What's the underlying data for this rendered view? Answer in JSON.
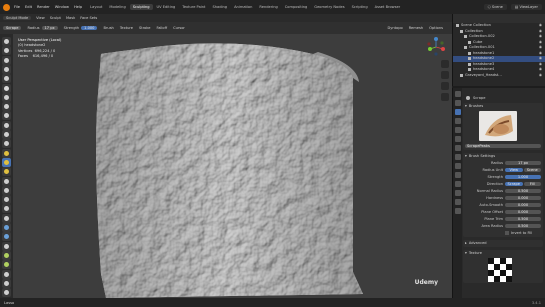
{
  "topbar": {
    "menus": [
      "File",
      "Edit",
      "Render",
      "Window",
      "Help"
    ],
    "workspaces": [
      "Layout",
      "Modeling",
      "Sculpting",
      "UV Editing",
      "Texture Paint",
      "Shading",
      "Animation",
      "Rendering",
      "Compositing",
      "Geometry Nodes",
      "Scripting",
      "Asset Browser"
    ],
    "active_workspace": "Sculpting",
    "scene": "Scene",
    "view_layer": "ViewLayer"
  },
  "header": {
    "mode": "Sculpt Mode",
    "menus": [
      "View",
      "Sculpt",
      "Mask",
      "Face Sets"
    ]
  },
  "tool_header": {
    "brush_name": "Scrape",
    "radius_label": "Radius",
    "radius_value": "17 px",
    "strength_label": "Strength",
    "strength_value": "1.000",
    "strength_fill": 1.0,
    "items": [
      "Brush",
      "Texture",
      "Stroke",
      "Falloff",
      "Cursor"
    ],
    "right_items": [
      "Dyntopo",
      "Remesh",
      "Options"
    ]
  },
  "viewport": {
    "view": "User Perspective (Local)",
    "object": "(0) headstone2",
    "vertices_label": "Vertices",
    "vertices_value": "696,224 / 0",
    "faces_label": "Faces",
    "faces_value": "616,496 / 0"
  },
  "outliner": {
    "rows": [
      {
        "label": "Scene Collection",
        "indent": 0,
        "selected": false
      },
      {
        "label": "Collection",
        "indent": 1,
        "selected": false
      },
      {
        "label": "Collection.002",
        "indent": 2,
        "selected": false
      },
      {
        "label": "Cube",
        "indent": 3,
        "selected": false
      },
      {
        "label": "Collection.001",
        "indent": 2,
        "selected": false
      },
      {
        "label": "headstone1",
        "indent": 3,
        "selected": false
      },
      {
        "label": "headstone2",
        "indent": 3,
        "selected": true
      },
      {
        "label": "headstone3",
        "indent": 3,
        "selected": false
      },
      {
        "label": "headstone4",
        "indent": 3,
        "selected": false
      },
      {
        "label": "Graveyard_Headst...",
        "indent": 1,
        "selected": false
      }
    ]
  },
  "properties": {
    "brush_title": "Scrape",
    "brushes_panel": "Brushes",
    "brush_field": "ScrapePeaks",
    "brush_settings_panel": "Brush Settings",
    "rows": [
      {
        "label": "Radius",
        "value": "17 px",
        "fill": 0.0
      },
      {
        "label": "Radius Unit",
        "value": "View",
        "fill": 0.0,
        "alt": "Scene"
      },
      {
        "label": "Strength",
        "value": "1.000",
        "fill": 1.0
      },
      {
        "label": "Direction",
        "value": "Scrape",
        "fill": 0.0,
        "alt": "Fill"
      },
      {
        "label": "Normal Radius",
        "value": "0.500",
        "fill": 0.0
      },
      {
        "label": "Hardness",
        "value": "0.000",
        "fill": 0.0
      },
      {
        "label": "Auto-Smooth",
        "value": "0.000",
        "fill": 0.0
      },
      {
        "label": "Plane Offset",
        "value": "0.000",
        "fill": 0.0
      },
      {
        "label": "Plane Trim",
        "value": "0.500",
        "fill": 0.0
      },
      {
        "label": "Area Radius",
        "value": "0.500",
        "fill": 0.0
      }
    ],
    "invert_label": "Invert to Fill",
    "advanced_panel": "Advanced",
    "texture_panel": "Texture"
  },
  "status": {
    "left": "Lasso",
    "version": "3.4.1"
  },
  "watermark": "Udemy",
  "colors": {
    "accent": "#4772b3",
    "active_tool": "#e87d0d",
    "viewport_bg": "#3d3d3d"
  }
}
